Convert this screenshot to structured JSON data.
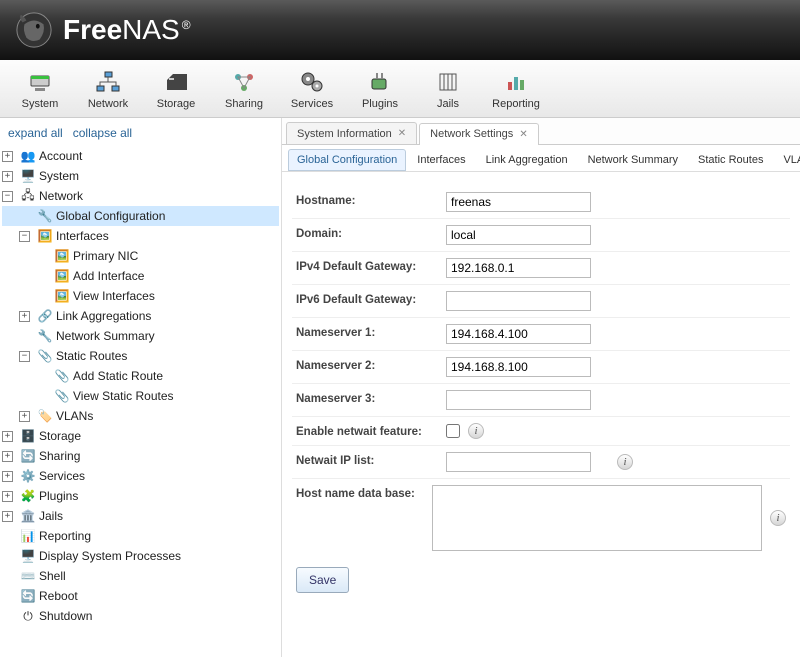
{
  "brand": {
    "name_bold": "Free",
    "name_rest": "NAS",
    "registered": "®"
  },
  "toolbar": [
    {
      "id": "system",
      "label": "System"
    },
    {
      "id": "network",
      "label": "Network"
    },
    {
      "id": "storage",
      "label": "Storage"
    },
    {
      "id": "sharing",
      "label": "Sharing"
    },
    {
      "id": "services",
      "label": "Services"
    },
    {
      "id": "plugins",
      "label": "Plugins"
    },
    {
      "id": "jails",
      "label": "Jails"
    },
    {
      "id": "reporting",
      "label": "Reporting"
    }
  ],
  "tree_controls": {
    "expand": "expand all",
    "collapse": "collapse all"
  },
  "tree": {
    "account": "Account",
    "system": "System",
    "network": "Network",
    "global_config": "Global Configuration",
    "interfaces": "Interfaces",
    "primary_nic": "Primary NIC",
    "add_interface": "Add Interface",
    "view_interfaces": "View Interfaces",
    "link_agg": "Link Aggregations",
    "net_summary": "Network Summary",
    "static_routes": "Static Routes",
    "add_static": "Add Static Route",
    "view_static": "View Static Routes",
    "vlans": "VLANs",
    "storage": "Storage",
    "sharing": "Sharing",
    "services": "Services",
    "plugins": "Plugins",
    "jails": "Jails",
    "reporting": "Reporting",
    "procs": "Display System Processes",
    "shell": "Shell",
    "reboot": "Reboot",
    "shutdown": "Shutdown"
  },
  "page_tabs": {
    "sysinfo": "System Information",
    "netset": "Network Settings"
  },
  "sub_tabs": {
    "global": "Global Configuration",
    "ifaces": "Interfaces",
    "lagg": "Link Aggregation",
    "summary": "Network Summary",
    "routes": "Static Routes",
    "vlan": "VLAN"
  },
  "form": {
    "labels": {
      "hostname": "Hostname:",
      "domain": "Domain:",
      "gw4": "IPv4 Default Gateway:",
      "gw6": "IPv6 Default Gateway:",
      "ns1": "Nameserver 1:",
      "ns2": "Nameserver 2:",
      "ns3": "Nameserver 3:",
      "netwait": "Enable netwait feature:",
      "netwait_ip": "Netwait IP list:",
      "hosts": "Host name data base:"
    },
    "values": {
      "hostname": "freenas",
      "domain": "local",
      "gw4": "192.168.0.1",
      "gw6": "",
      "ns1": "194.168.4.100",
      "ns2": "194.168.8.100",
      "ns3": "",
      "netwait_ip": "",
      "hosts": ""
    },
    "save": "Save"
  }
}
